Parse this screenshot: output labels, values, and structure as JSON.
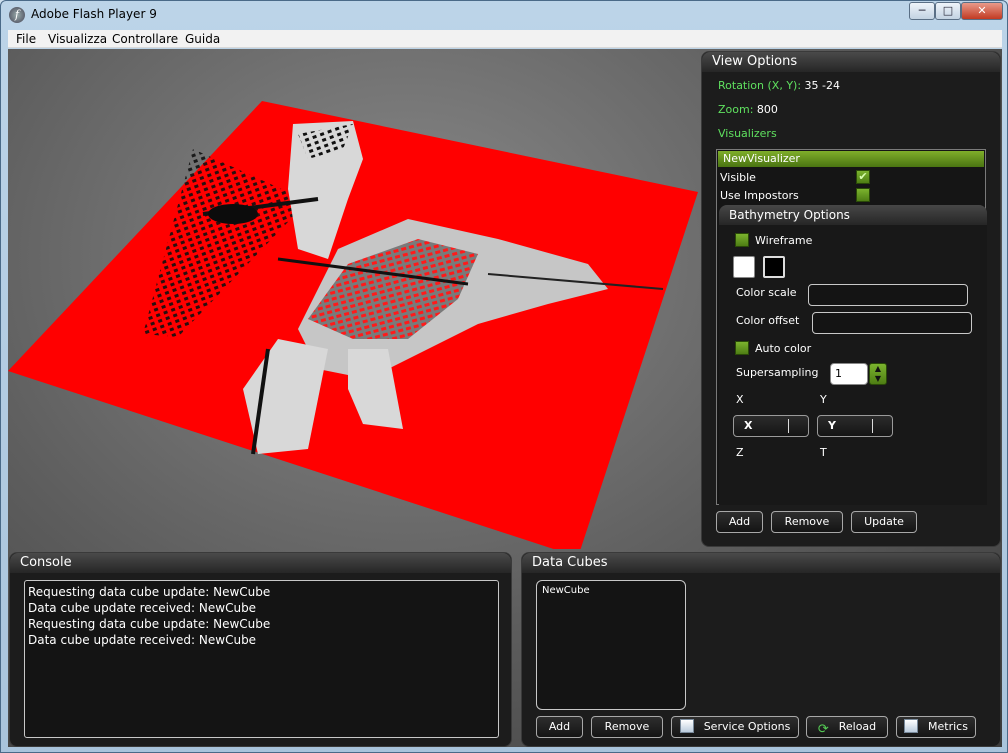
{
  "window": {
    "title": "Adobe Flash Player 9",
    "minimize": "─",
    "maximize": "□",
    "close": "✕"
  },
  "menu": [
    "File",
    "Visualizza",
    "Controllare",
    "Guida"
  ],
  "colors": {
    "plane": "#ff0000",
    "accent": "#6a9a1e",
    "label_green": "#5fe05f"
  },
  "view_options": {
    "title": "View Options",
    "rotation_label": "Rotation (X, Y):",
    "rotation_value": "35 -24",
    "zoom_label": "Zoom:",
    "zoom_value": "800",
    "visualizers_label": "Visualizers",
    "visualizers": [
      {
        "name": "NewVisualizer",
        "selected": true
      }
    ],
    "visible_label": "Visible",
    "visible_checked": true,
    "impostors_label": "Use Impostors",
    "impostors_checked": false,
    "bathymetry": {
      "title": "Bathymetry Options",
      "wireframe_label": "Wireframe",
      "wireframe_checked": false,
      "color_scale_label": "Color scale",
      "color_scale_value": "",
      "color_offset_label": "Color offset",
      "color_offset_value": "",
      "auto_color_label": "Auto color",
      "auto_color_checked": false,
      "supersampling_label": "Supersampling",
      "supersampling_value": "1",
      "x_label": "X",
      "y_label": "Y",
      "z_label": "Z",
      "t_label": "T",
      "x_select": "X",
      "y_select": "Y"
    },
    "buttons": {
      "add": "Add",
      "remove": "Remove",
      "update": "Update"
    }
  },
  "console": {
    "title": "Console",
    "lines": [
      "Requesting data cube update: NewCube",
      "Data cube update received: NewCube",
      "Requesting data cube update: NewCube",
      "Data cube update received: NewCube"
    ]
  },
  "data_cubes": {
    "title": "Data Cubes",
    "items": [
      "NewCube"
    ],
    "buttons": {
      "add": "Add",
      "remove": "Remove",
      "service_options": "Service Options",
      "reload": "Reload",
      "metrics": "Metrics"
    }
  }
}
